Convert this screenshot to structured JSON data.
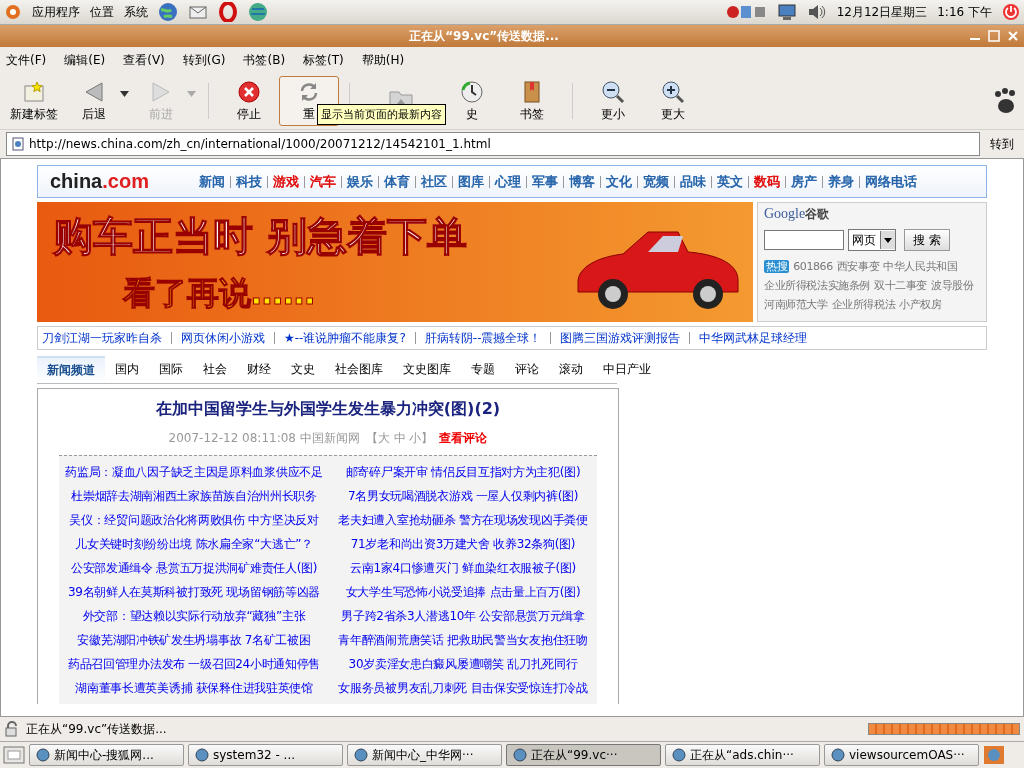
{
  "panel": {
    "menus": [
      "应用程序",
      "位置",
      "系统"
    ],
    "date": "12月12日星期三",
    "time": "1:16 下午"
  },
  "window": {
    "title": "正在从“99.vc”传送数据..."
  },
  "menubar": [
    "文件(F)",
    "编辑(E)",
    "查看(V)",
    "转到(G)",
    "书签(B)",
    "标签(T)",
    "帮助(H)"
  ],
  "toolbar": [
    {
      "label": "新建标签",
      "disabled": false,
      "hovered": false,
      "has_menu": false
    },
    {
      "label": "后退",
      "disabled": false,
      "hovered": false,
      "has_menu": true
    },
    {
      "label": "前进",
      "disabled": true,
      "hovered": false,
      "has_menu": true
    },
    {
      "label": "停止",
      "disabled": false,
      "hovered": false,
      "has_menu": false
    },
    {
      "label": "重",
      "disabled": false,
      "hovered": true,
      "has_menu": false
    },
    {
      "disabled": true,
      "hovered": false,
      "has_menu": false
    },
    {
      "label": "史",
      "disabled": false,
      "hovered": false,
      "has_menu": false
    },
    {
      "label": "书签",
      "disabled": false,
      "hovered": false,
      "has_menu": false
    },
    {
      "label": "更小",
      "disabled": false,
      "hovered": false,
      "has_menu": false
    },
    {
      "label": "更大",
      "disabled": false,
      "hovered": false,
      "has_menu": false
    }
  ],
  "tooltip": "显示当前页面的最新内容",
  "address": {
    "value": "http://news.china.com/zh_cn/international/1000/20071212/14542101_1.html",
    "go": "转到"
  },
  "page": {
    "logo_name": "china",
    "logo_suffix": ".com",
    "nav": [
      {
        "label": "新闻",
        "color": "#1f5fa8"
      },
      {
        "label": "科技",
        "color": "#1f5fa8"
      },
      {
        "label": "游戏",
        "color": "#e00000"
      },
      {
        "label": "汽车",
        "color": "#e00000"
      },
      {
        "label": "娱乐",
        "color": "#1f5fa8"
      },
      {
        "label": "体育",
        "color": "#1f5fa8"
      },
      {
        "label": "社区",
        "color": "#1f5fa8"
      },
      {
        "label": "图库",
        "color": "#1f5fa8"
      },
      {
        "label": "心理",
        "color": "#1f5fa8"
      },
      {
        "label": "军事",
        "color": "#1f5fa8"
      },
      {
        "label": "博客",
        "color": "#1f5fa8"
      },
      {
        "label": "文化",
        "color": "#1f5fa8"
      },
      {
        "label": "宽频",
        "color": "#1f5fa8"
      },
      {
        "label": "品味",
        "color": "#1f5fa8"
      },
      {
        "label": "英文",
        "color": "#1f5fa8"
      },
      {
        "label": "数码",
        "color": "#e00000"
      },
      {
        "label": "房产",
        "color": "#1f5fa8"
      },
      {
        "label": "养身",
        "color": "#1f5fa8"
      },
      {
        "label": "网络电话",
        "color": "#1f5fa8"
      }
    ],
    "banner": {
      "headline": "购车正当时 别急着下单",
      "subline": "看了再说……"
    },
    "search": {
      "logo": "Google",
      "logo_cn": "谷歌",
      "scope": "网页",
      "button": "搜 索",
      "hot_label": "热搜",
      "hot_words": [
        "601866",
        "西安事变",
        "中华人民共和国",
        "企业所得税法实施条例",
        "双十二事变",
        "波导股份",
        "河南师范大学",
        "企业所得税法",
        "小产权房"
      ]
    },
    "promo_links": [
      "刀剑江湖一玩家昨自杀",
      "网页休闲小游戏",
      "★--谁说肿瘤不能康复?",
      "肝病转阴--震撼全球！",
      "图腾三国游戏评测报告",
      "中华网武林足球经理"
    ],
    "channels": [
      {
        "label": "新闻频道",
        "selected": true
      },
      {
        "label": "国内",
        "selected": false
      },
      {
        "label": "国际",
        "selected": false
      },
      {
        "label": "社会",
        "selected": false
      },
      {
        "label": "财经",
        "selected": false
      },
      {
        "label": "文史",
        "selected": false
      },
      {
        "label": "社会图库",
        "selected": false
      },
      {
        "label": "文史图库",
        "selected": false
      },
      {
        "label": "专题",
        "selected": false
      },
      {
        "label": "评论",
        "selected": false
      },
      {
        "label": "滚动",
        "selected": false
      },
      {
        "label": "中日产业",
        "selected": false
      }
    ],
    "article": {
      "title": "在加中国留学生与外国学生发生暴力冲突(图)(2)",
      "meta": "2007-12-12 08:11:08 中国新闻网",
      "sizes": "【大 中 小】",
      "comments": "查看评论",
      "links": [
        [
          "药监局：凝血八因子缺乏主因是原料血浆供应不足",
          "邮寄碎尸案开审 情侣反目互指对方为主犯(图)"
        ],
        [
          "杜崇烟辞去湖南湘西土家族苗族自治州州长职务",
          "7名男女玩喝酒脱衣游戏 一屋人仅剩内裤(图)"
        ],
        [
          "吴仪：经贸问题政治化将两败俱伤 中方坚决反对",
          "老夫妇遭入室抢劫砸杀 警方在现场发现凶手粪便"
        ],
        [
          "儿女关键时刻纷纷出境 陈水扁全家“大逃亡”？",
          "71岁老和尚出资3万建犬舍 收养32条狗(图)"
        ],
        [
          "公安部发通缉令 悬赏五万捉洪洞矿难责任人(图)",
          "云南1家4口惨遭灭门 鲜血染红衣服被子(图)"
        ],
        [
          "39名朝鲜人在莫斯科被打致死 现场留钢筋等凶器",
          "女大学生写恐怖小说受追捧 点击量上百万(图)"
        ],
        [
          "外交部：望达赖以实际行动放弃“藏独”主张",
          "男子跨2省杀3人潜逃10年 公安部悬赏万元缉拿"
        ],
        [
          "安徽芜湖阳冲铁矿发生坍塌事故 7名矿工被困",
          "青年醉酒闹荒唐笑话 把救助民警当女友抱住狂吻"
        ],
        [
          "药品召回管理办法发布 一级召回24小时通知停售",
          "30岁卖淫女患白癜风屡遭嘲笑 乱刀扎死同行"
        ],
        [
          "湖南董事长遭英美诱捕 获保释住进我驻英使馆",
          "女服务员被男友乱刀刺死 目击保安受惊连打冷战"
        ]
      ]
    }
  },
  "status": {
    "text": "正在从“99.vc”传送数据...",
    "level": 1
  },
  "taskbar": [
    {
      "label": "新闻中心-搜狐网...",
      "selected": false
    },
    {
      "label": "system32 - ...",
      "selected": false
    },
    {
      "label": "新闻中心_中华网···",
      "selected": false
    },
    {
      "label": "正在从“99.vc···",
      "selected": true
    },
    {
      "label": "正在从“ads.chin···",
      "selected": false
    },
    {
      "label": "viewsourcemOAS···",
      "selected": false
    }
  ]
}
